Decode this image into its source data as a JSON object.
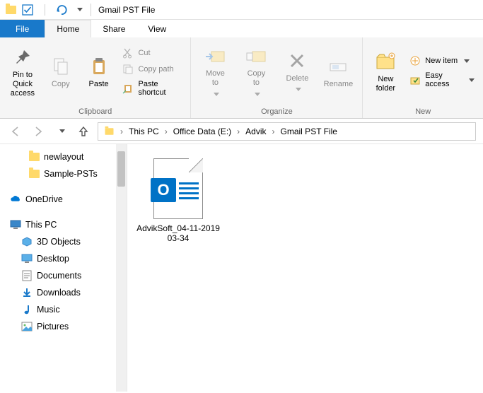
{
  "window": {
    "title": "Gmail PST File"
  },
  "tabs": {
    "file": "File",
    "home": "Home",
    "share": "Share",
    "view": "View"
  },
  "ribbon": {
    "pin": "Pin to Quick\naccess",
    "copy": "Copy",
    "paste": "Paste",
    "cut": "Cut",
    "copypath": "Copy path",
    "pasteshortcut": "Paste shortcut",
    "clipboard_label": "Clipboard",
    "moveto": "Move\nto",
    "copyto": "Copy\nto",
    "delete": "Delete",
    "rename": "Rename",
    "organize_label": "Organize",
    "newfolder": "New\nfolder",
    "newitem": "New item",
    "easyaccess": "Easy access",
    "new_label": "New"
  },
  "breadcrumb": [
    "This PC",
    "Office Data (E:)",
    "Advik",
    "Gmail PST File"
  ],
  "tree": {
    "folders": [
      "newlayout",
      "Sample-PSTs"
    ],
    "onedrive": "OneDrive",
    "thispc": "This PC",
    "items": [
      "3D Objects",
      "Desktop",
      "Documents",
      "Downloads",
      "Music",
      "Pictures"
    ]
  },
  "files": {
    "item0": "AdvikSoft_04-11-2019 03-34"
  }
}
